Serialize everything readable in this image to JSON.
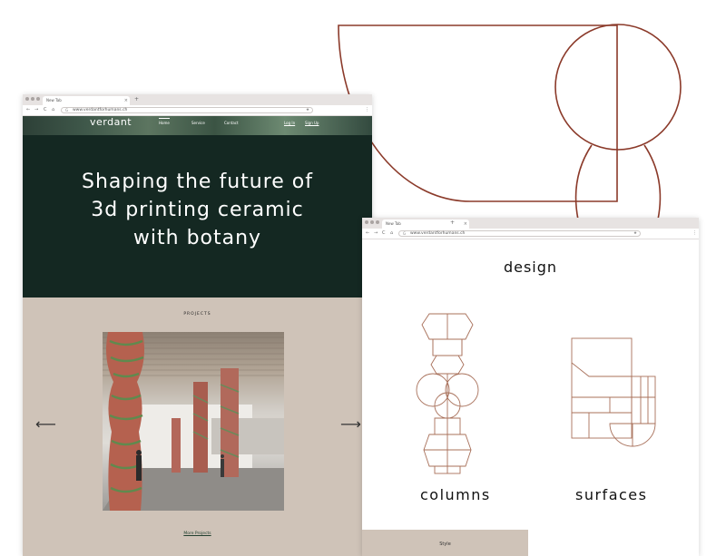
{
  "colors": {
    "accent_line": "#8b3a2a",
    "thin_line": "#a8705a",
    "hero_bg": "#142822",
    "beige": "#cfc3b8"
  },
  "browser_left": {
    "tab_title": "New Tab",
    "tab_close": "×",
    "new_tab": "+",
    "url": "www.verdantforhumans.ch",
    "nav": {
      "back": "←",
      "forward": "→",
      "reload": "C",
      "home": "⌂"
    },
    "omnibox_icon": "G",
    "star": "★",
    "menu": "⋮"
  },
  "site": {
    "logo": "verdant",
    "menu": [
      "Home",
      "Service",
      "Contact"
    ],
    "auth": [
      "Log In",
      "Sign Up"
    ],
    "hero_lines": [
      "Shaping the future of",
      "3d printing ceramic",
      "with botany"
    ],
    "projects_label": "PROJECTS",
    "arrow_left": "⟵",
    "arrow_right": "⟶",
    "more_link": "More Projects"
  },
  "browser_right": {
    "tab_title": "New Tab",
    "tab_close": "×",
    "new_tab": "+",
    "url": "www.verdantforhumans.ch",
    "nav": {
      "back": "←",
      "forward": "→",
      "reload": "C",
      "home": "⌂"
    },
    "omnibox_icon": "G",
    "star": "★",
    "menu": "⋮"
  },
  "design": {
    "title": "design",
    "columns_label": "columns",
    "surfaces_label": "surfaces",
    "style_label": "Style"
  }
}
